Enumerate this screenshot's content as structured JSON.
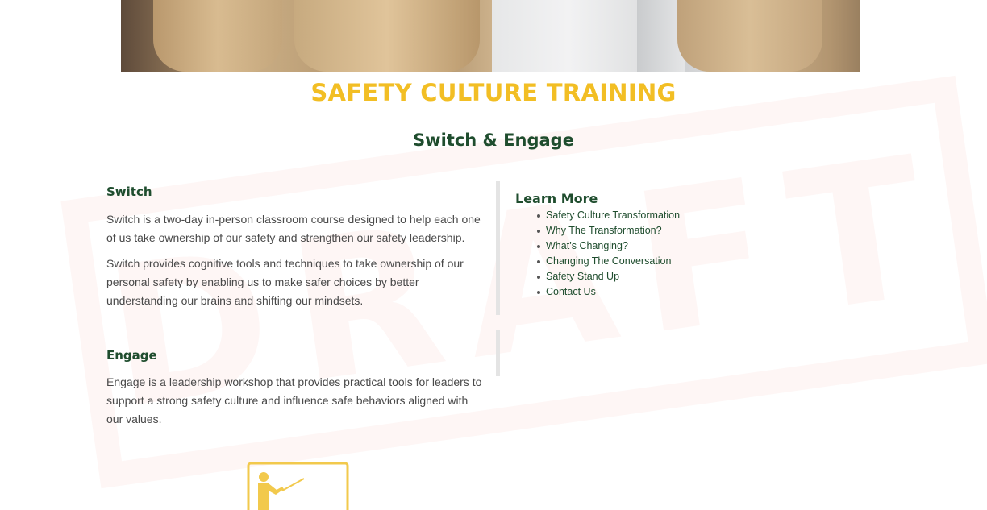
{
  "page": {
    "title": "SAFETY CULTURE TRAINING",
    "subtitle": "Switch & Engage",
    "watermark": "DRAFT"
  },
  "switch": {
    "heading": "Switch",
    "paragraph1": "Switch is a two-day in-person classroom course designed to help each one of us take ownership of our safety and strengthen our safety leadership.",
    "paragraph2": "Switch provides cognitive tools and techniques to take ownership of our personal safety by enabling us to make safer choices by better understanding our brains and shifting our mindsets."
  },
  "engage": {
    "heading": "Engage",
    "paragraph": "Engage is a leadership workshop that provides practical tools for leaders to support a strong safety culture and influence safe behaviors aligned with our values."
  },
  "learn_more": {
    "heading": "Learn More",
    "links": [
      "Safety Culture Transformation",
      "Why The Transformation?",
      "What’s Changing?",
      "Changing The Conversation",
      "Safety Stand Up",
      "Contact Us"
    ]
  },
  "colors": {
    "title_yellow": "#f2be24",
    "heading_green": "#1f4d2e",
    "icon_yellow": "#f2c94c"
  },
  "icons": {
    "hero": "training-photo",
    "bottom": "presenter-whiteboard-icon"
  }
}
